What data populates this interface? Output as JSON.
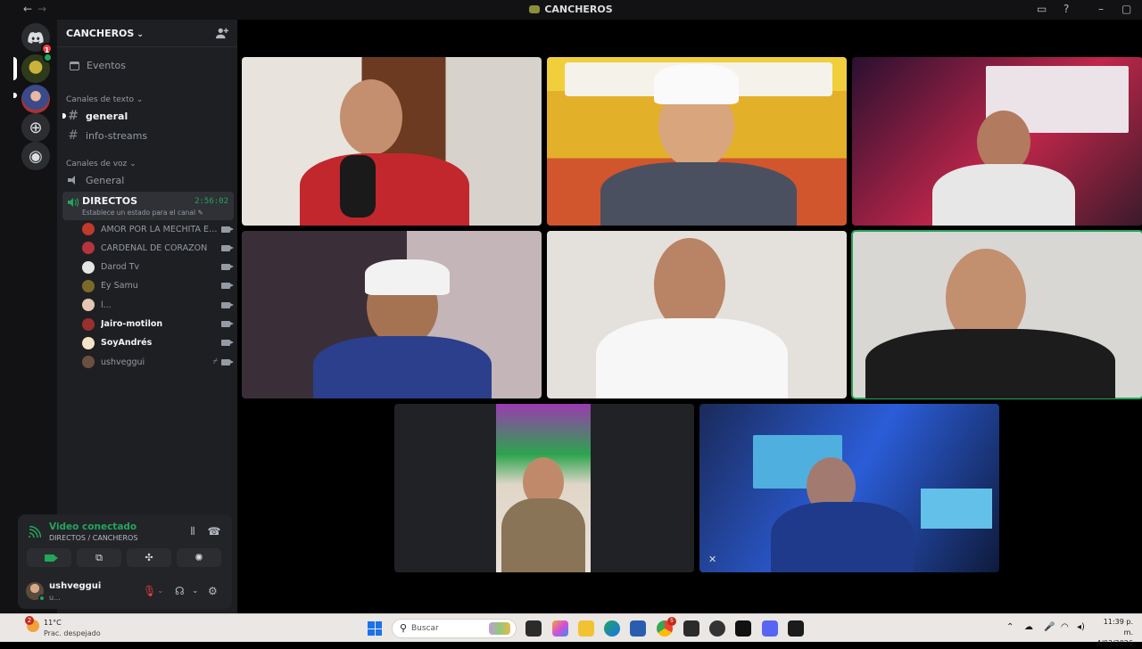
{
  "window": {
    "title": "CANCHEROS",
    "back": "←",
    "forward": "→"
  },
  "rail": {
    "dm_badge": "1"
  },
  "guild": {
    "name": "CANCHEROS",
    "events_label": "Eventos",
    "text_category": "Canales de texto",
    "text_channels": [
      {
        "label": "general"
      },
      {
        "label": "info-streams"
      }
    ],
    "voice_category": "Canales de voz",
    "voice_channels": [
      {
        "label": "General"
      },
      {
        "label": "DIRECTOS",
        "timer": "2:56:02",
        "status": "Establece un estado para el canal"
      }
    ],
    "members": [
      {
        "name": "AMOR POR LA MECHITA EN ...",
        "color": "#c0392b"
      },
      {
        "name": "CARDENAL DE CORAZON",
        "color": "#b3343c"
      },
      {
        "name": "Darod Tv",
        "color": "#e5e5e5"
      },
      {
        "name": "Ey Samu",
        "color": "#7a6a2a"
      },
      {
        "name": "l...",
        "color": "#e4c6b4"
      },
      {
        "name": "Jairo-motilon",
        "color": "#9a2f2f"
      },
      {
        "name": "SoyAndrés",
        "color": "#f3e3c8"
      },
      {
        "name": "ushveggui",
        "color": "#6b5040"
      }
    ]
  },
  "voice_panel": {
    "title": "Video conectado",
    "subtitle": "DIRECTOS / CANCHEROS"
  },
  "user": {
    "name": "ushveggui",
    "status": "u..."
  },
  "taskbar": {
    "weather_badge": "2",
    "temperature": "11°C",
    "condition": "Prac. despejado",
    "search_placeholder": "Buscar",
    "chrome_badge": "5",
    "time": "11:39 p. m.",
    "date": "4/03/2026"
  }
}
